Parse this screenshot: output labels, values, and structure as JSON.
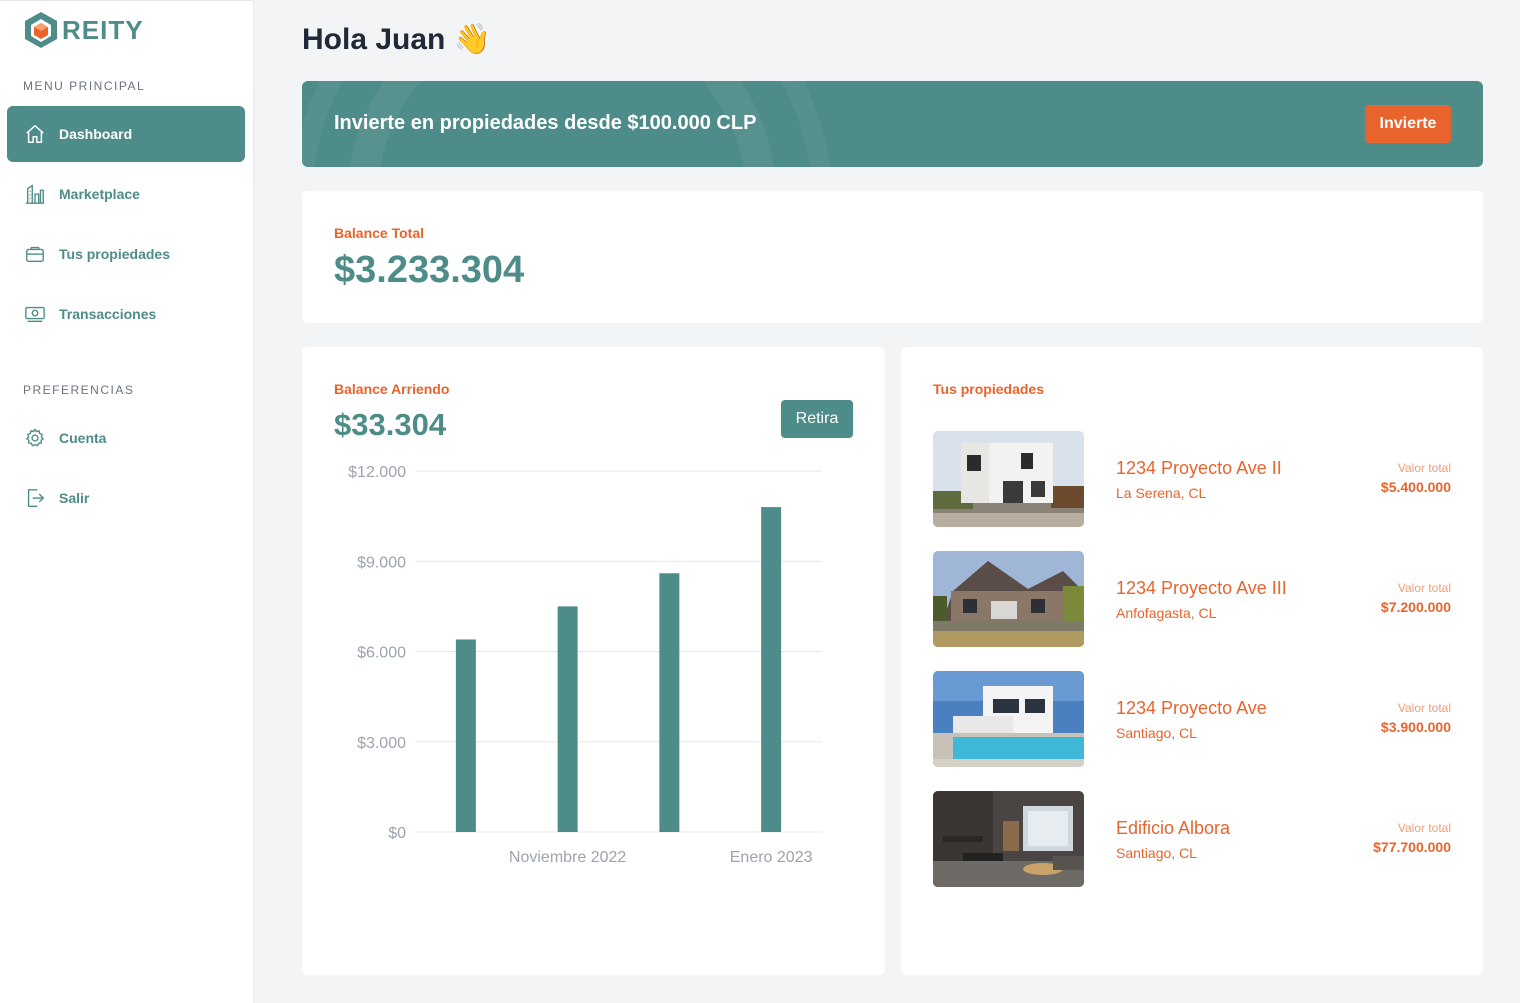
{
  "brand": {
    "name": "REITY"
  },
  "sidebar": {
    "main_title": "MENU PRINCIPAL",
    "main_items": [
      {
        "label": "Dashboard",
        "icon": "home-icon",
        "active": true
      },
      {
        "label": "Marketplace",
        "icon": "buildings-chart-icon",
        "active": false
      },
      {
        "label": "Tus propiedades",
        "icon": "briefcase-icon",
        "active": false
      },
      {
        "label": "Transacciones",
        "icon": "money-bill-icon",
        "active": false
      }
    ],
    "prefs_title": "PREFERENCIAS",
    "pref_items": [
      {
        "label": "Cuenta",
        "icon": "gear-icon"
      },
      {
        "label": "Salir",
        "icon": "logout-icon"
      }
    ]
  },
  "header": {
    "greeting": "Hola Juan 👋"
  },
  "banner": {
    "text": "Invierte en propiedades desde $100.000 CLP",
    "button": "Invierte"
  },
  "balance_total": {
    "label": "Balance Total",
    "value": "$3.233.304"
  },
  "balance_arriendo": {
    "label": "Balance Arriendo",
    "value": "$33.304",
    "button": "Retira"
  },
  "properties": {
    "title": "Tus propiedades",
    "value_label": "Valor total",
    "items": [
      {
        "name": "1234 Proyecto Ave II",
        "location": "La Serena, CL",
        "value": "$5.400.000",
        "thumb": "modern-white-house"
      },
      {
        "name": "1234 Proyecto Ave III",
        "location": "Anfofagasta, CL",
        "value": "$7.200.000",
        "thumb": "brick-suburban-house"
      },
      {
        "name": "1234 Proyecto Ave",
        "location": "Santiago, CL",
        "value": "$3.900.000",
        "thumb": "villa-with-pool"
      },
      {
        "name": "Edificio Albora",
        "location": "Santiago, CL",
        "value": "$77.700.000",
        "thumb": "apartment-interior"
      }
    ]
  },
  "colors": {
    "accent": "#4e8c89",
    "orange": "#e8642c",
    "background": "#f3f4f6"
  },
  "chart_data": {
    "type": "bar",
    "categories": [
      "",
      "Noviembre 2022",
      "",
      "Enero 2023"
    ],
    "values": [
      6400,
      7500,
      8600,
      10800
    ],
    "yticks": [
      "$0",
      "$3.000",
      "$6.000",
      "$9.000",
      "$12.000"
    ],
    "ylim": [
      0,
      12000
    ],
    "grid": true,
    "color": "#4e8c89"
  }
}
